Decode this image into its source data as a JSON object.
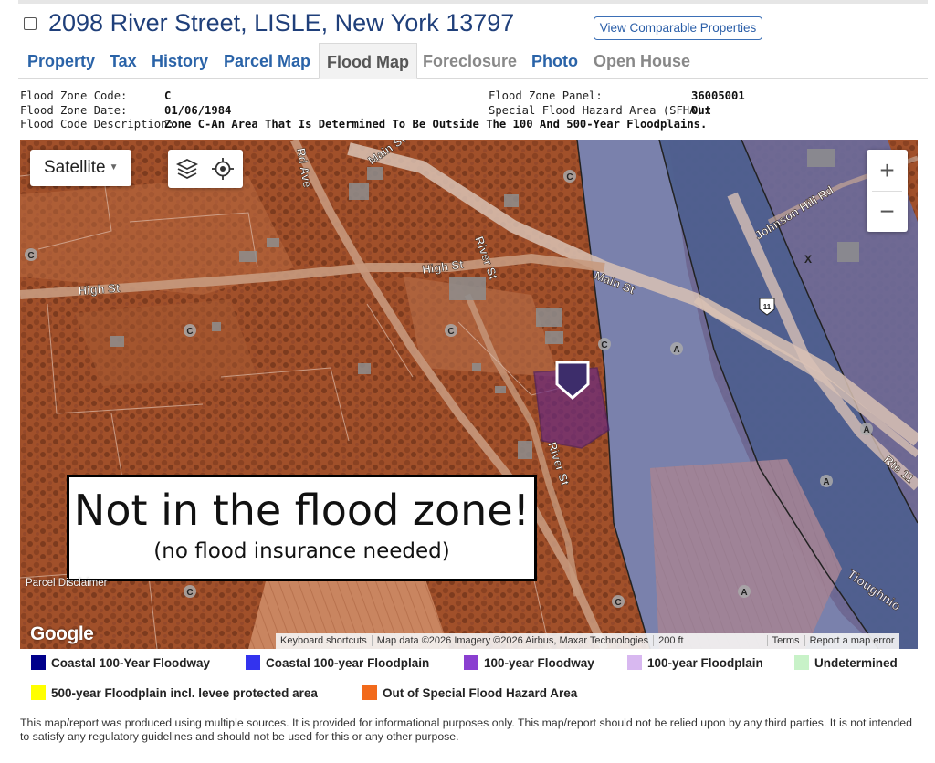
{
  "header": {
    "title": "2098 River Street, LISLE, New York 13797",
    "comparable_button": "View Comparable Properties"
  },
  "tabs": [
    {
      "label": "Property",
      "state": "link"
    },
    {
      "label": "Tax",
      "state": "link"
    },
    {
      "label": "History",
      "state": "link"
    },
    {
      "label": "Parcel Map",
      "state": "link"
    },
    {
      "label": "Flood Map",
      "state": "active"
    },
    {
      "label": "Foreclosure",
      "state": "disabled"
    },
    {
      "label": "Photo",
      "state": "link"
    },
    {
      "label": "Open House",
      "state": "disabled"
    }
  ],
  "flood_info": {
    "zone_code_label": "Flood Zone Code:",
    "zone_code": "C",
    "zone_date_label": "Flood Zone Date:",
    "zone_date": "01/06/1984",
    "description_label": "Flood Code Description:",
    "description": "Zone C-An Area That Is Determined To Be Outside The 100 And 500-Year Floodplains.",
    "panel_label": "Flood Zone Panel:",
    "panel": "36005001",
    "sfha_label": "Special Flood Hazard Area (SFHA):",
    "sfha": "Out"
  },
  "map": {
    "type_label": "Satellite",
    "zoom_in": "+",
    "zoom_out": "−",
    "callout_title": "Not in the flood zone!",
    "callout_subtitle": "(no flood insurance needed)",
    "google_logo": "Google",
    "parcel_disclaimer": "Parcel Disclaimer",
    "attribution": {
      "shortcuts": "Keyboard shortcuts",
      "data": "Map data ©2026 Imagery ©2026 Airbus, Maxar Technologies",
      "scale": "200 ft",
      "terms": "Terms",
      "report": "Report a map error"
    },
    "street_labels": {
      "main_st": "Main St",
      "main_st_2": "Main St",
      "high_st": "High St",
      "high_st_2": "High St",
      "river_st": "River St",
      "river_st_2": "River St",
      "rd_ave": "Rd Ave",
      "johnson_hill": "Johnson Hill Rd",
      "rte": "Rte 11",
      "river_name": "Tioughnio",
      "us_route": "11"
    },
    "zone_markers": {
      "c": "C",
      "a": "A",
      "x": "X"
    }
  },
  "legend": [
    {
      "label": "Coastal 100-Year Floodway",
      "color": "#00008b"
    },
    {
      "label": "Coastal 100-year Floodplain",
      "color": "#3333ee"
    },
    {
      "label": "100-year Floodway",
      "color": "#8a3fd0"
    },
    {
      "label": "100-year Floodplain",
      "color": "#d8b8f0"
    },
    {
      "label": "Undetermined",
      "color": "#c8f2c8"
    },
    {
      "label": "500-year Floodplain incl. levee protected area",
      "color": "#ffff00"
    },
    {
      "label": "Out of Special Flood Hazard Area",
      "color": "#f26a1b"
    }
  ],
  "disclaimer": "This map/report was produced using multiple sources. It is provided for informational purposes only. This map/report should not be relied upon by any third parties. It is not intended to satisfy any regulatory guidelines and should not be used for this or any other purpose."
}
